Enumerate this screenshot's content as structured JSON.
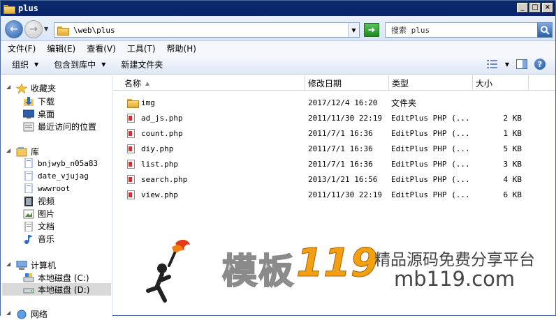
{
  "window": {
    "title": "plus"
  },
  "address": {
    "path": "\\web\\plus",
    "search_placeholder": "搜索 plus"
  },
  "menu": [
    "文件(F)",
    "编辑(E)",
    "查看(V)",
    "工具(T)",
    "帮助(H)"
  ],
  "toolbar": {
    "organize": "组织",
    "include_library": "包含到库中",
    "new_folder": "新建文件夹"
  },
  "nav": {
    "favorites": "收藏夹",
    "downloads": "下载",
    "desktop": "桌面",
    "recent": "最近访问的位置",
    "libraries": "库",
    "lib1": "bnjwyb_n05a83",
    "lib2": "date_vjujag",
    "lib3": "wwwroot",
    "video": "视频",
    "pictures": "图片",
    "documents": "文档",
    "music": "音乐",
    "computer": "计算机",
    "disk_c": "本地磁盘 (C:)",
    "disk_d": "本地磁盘 (D:)",
    "network": "网络"
  },
  "columns": {
    "name": "名称",
    "modified": "修改日期",
    "type": "类型",
    "size": "大小"
  },
  "files": [
    {
      "name": "img",
      "modified": "2017/12/4 16:20",
      "type": "文件夹",
      "size": "",
      "icon": "folder-icon"
    },
    {
      "name": "ad_js.php",
      "modified": "2011/11/30 22:19",
      "type": "EditPlus PHP (...",
      "size": "2 KB",
      "icon": "php-file-icon"
    },
    {
      "name": "count.php",
      "modified": "2011/7/1 16:36",
      "type": "EditPlus PHP (...",
      "size": "1 KB",
      "icon": "php-file-icon"
    },
    {
      "name": "diy.php",
      "modified": "2011/7/1 16:36",
      "type": "EditPlus PHP (...",
      "size": "5 KB",
      "icon": "php-file-icon"
    },
    {
      "name": "list.php",
      "modified": "2011/7/1 16:36",
      "type": "EditPlus PHP (...",
      "size": "3 KB",
      "icon": "php-file-icon"
    },
    {
      "name": "search.php",
      "modified": "2013/1/21 16:56",
      "type": "EditPlus PHP (...",
      "size": "4 KB",
      "icon": "php-file-icon"
    },
    {
      "name": "view.php",
      "modified": "2011/11/30 22:19",
      "type": "EditPlus PHP (...",
      "size": "6 KB",
      "icon": "php-file-icon"
    }
  ],
  "watermark": {
    "cn": "模板",
    "num": "119",
    "tagline": "精品源码免费分享平台",
    "url": "mb119.com"
  }
}
